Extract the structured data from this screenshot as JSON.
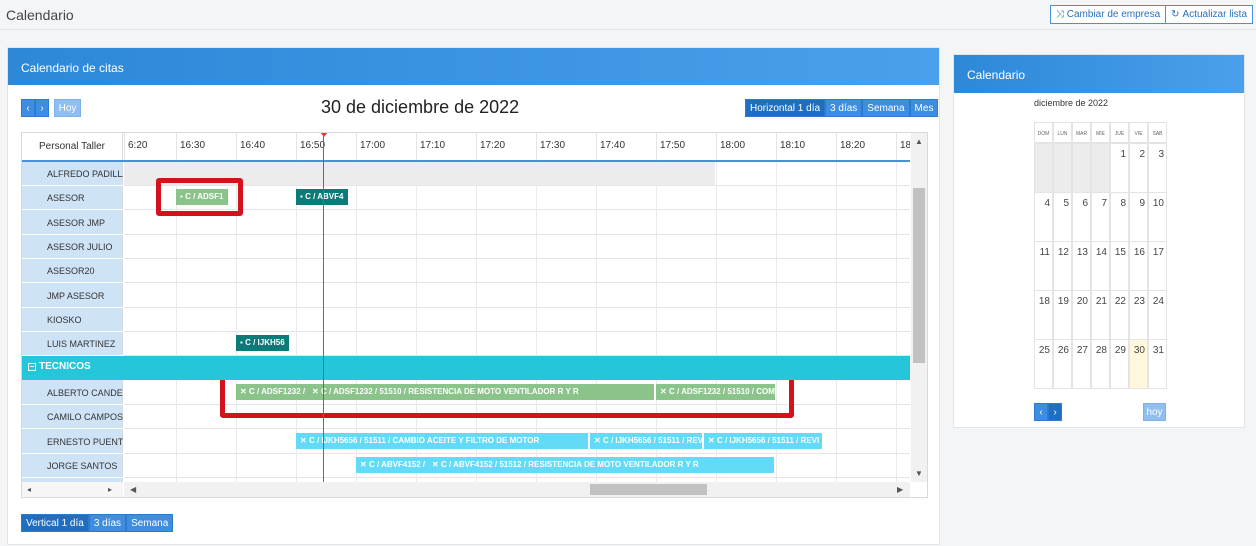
{
  "page": {
    "title": "Calendario",
    "actions": [
      "Cambiar de empresa",
      "Actualizar lista"
    ]
  },
  "main": {
    "panel_title": "Calendario de citas",
    "date_title": "30 de diciembre de 2022",
    "today_label": "Hoy",
    "views_top": [
      "Horizontal 1 día",
      "3 días",
      "Semana",
      "Mes"
    ],
    "views_bottom": [
      "Vertical 1 día",
      "3 días",
      "Semana"
    ],
    "resource_header": "Personal Taller",
    "ticks": [
      "6:20",
      "16:30",
      "16:40",
      "16:50",
      "17:00",
      "17:10",
      "17:20",
      "17:30",
      "17:40",
      "17:50",
      "18:00",
      "18:10",
      "18:20",
      "18"
    ],
    "resources": [
      "ALFREDO PADILLA",
      "ASESOR",
      "ASESOR JMP",
      "ASESOR JULIO",
      "ASESOR20",
      "JMP ASESOR",
      "KIOSKO",
      "LUIS MARTINEZ"
    ],
    "group": "TECNICOS",
    "technicians": [
      "ALBERTO CANDELARIA",
      "CAMILO CAMPOS",
      "ERNESTO PUENTE",
      "JORGE SANTOS"
    ],
    "events": [
      {
        "text": "C / ADSF1",
        "color": "green"
      },
      {
        "text": "C / ABVF4",
        "color": "teal"
      },
      {
        "text": "C / IJKH56",
        "color": "teal"
      },
      {
        "text": "C / ADSF1232 /",
        "color": "green"
      },
      {
        "text": "C / ADSF1232 / 51510 / RESISTENCIA DE MOTO VENTILADOR R Y R",
        "color": "green"
      },
      {
        "text": "C / ADSF1232 / 51510 / COM",
        "color": "green"
      },
      {
        "text": "C / IJKH5656 / 51511 / CAMBIO ACEITE Y FILTRO DE MOTOR",
        "color": "cyan"
      },
      {
        "text": "C / IJKH5656 / 51511 / REV",
        "color": "cyan"
      },
      {
        "text": "C / IJKH5656 / 51511 / REVI",
        "color": "cyan"
      },
      {
        "text": "C / ABVF4152 /",
        "color": "cyan"
      },
      {
        "text": "C / ABVF4152 / 51512 / RESISTENCIA DE MOTO VENTILADOR R Y R",
        "color": "cyan"
      }
    ]
  },
  "side": {
    "panel_title": "Calendario",
    "month_title": "diciembre de 2022",
    "dow": [
      "DOM",
      "LUN",
      "MAR",
      "MIE",
      "JUE",
      "VIE",
      "SAB"
    ],
    "weeks": [
      [
        "",
        "",
        "",
        "",
        "1",
        "2",
        "3"
      ],
      [
        "4",
        "5",
        "6",
        "7",
        "8",
        "9",
        "10"
      ],
      [
        "11",
        "12",
        "13",
        "14",
        "15",
        "16",
        "17"
      ],
      [
        "18",
        "19",
        "20",
        "21",
        "22",
        "23",
        "24"
      ],
      [
        "25",
        "26",
        "27",
        "28",
        "29",
        "30",
        "31"
      ]
    ],
    "today_day": "30",
    "today_label": "hoy"
  },
  "colors": {
    "accent": "#2d88d8",
    "group": "#26c6da",
    "now_line": "#e53935",
    "highlight": "#d3121b"
  }
}
